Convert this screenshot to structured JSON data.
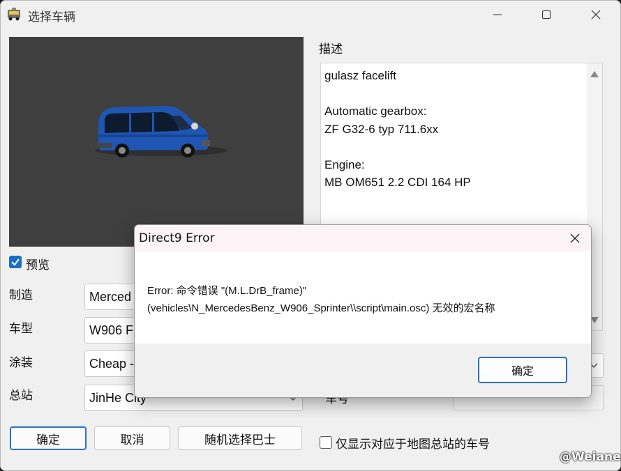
{
  "window": {
    "title": "选择车辆",
    "controls": {
      "minimize": "—",
      "maximize": "☐",
      "close": "✕"
    }
  },
  "preview": {
    "checkbox_label": "预览",
    "checked": true,
    "vehicle_color": "#1f56b3"
  },
  "description": {
    "label": "描述",
    "text": "gulasz facelift\n\nAutomatic gearbox:\nZF G32-6 typ 711.6xx\n\nEngine:\nMB OM651 2.2 CDI 164 HP"
  },
  "fields": {
    "manufacturer": {
      "label": "制造",
      "value": "Merced"
    },
    "model": {
      "label": "车型",
      "value": "W906 F"
    },
    "livery": {
      "label": "涂装",
      "value": "Cheap -"
    },
    "depot": {
      "label": "总站",
      "value": "JinHe City"
    }
  },
  "right_panel": {
    "partial_label": "车号"
  },
  "buttons": {
    "ok": "确定",
    "cancel": "取消",
    "random": "随机选择巴士"
  },
  "filter_checkbox": {
    "label": "仅显示对应于地图总站的车号",
    "checked": false
  },
  "dialog": {
    "title": "Direct9 Error",
    "message": "Error: 命令错误 \"(M.L.DrB_frame)\"\n(vehicles\\N_MercedesBenz_W906_Sprinter\\\\script\\main.osc) 无效的宏名称",
    "ok_label": "确定"
  },
  "watermark": "@Weiane",
  "colors": {
    "accent": "#1a6fc4",
    "preview_bg": "#3f3f3f",
    "dialog_title_bg": "#fbf3f6"
  }
}
